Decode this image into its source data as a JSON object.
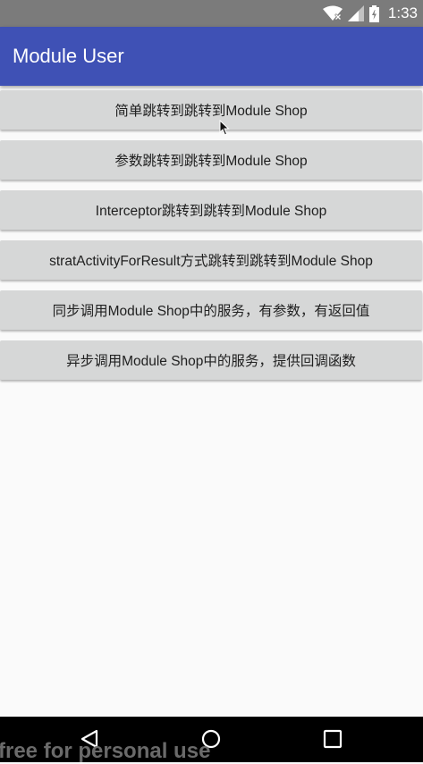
{
  "status_bar": {
    "time": "1:33",
    "icons": [
      "wifi-icon",
      "signal-icon",
      "battery-icon"
    ]
  },
  "toolbar": {
    "title": "Module User",
    "color": "#3f51b5"
  },
  "buttons": [
    {
      "label": "简单跳转到跳转到Module Shop"
    },
    {
      "label": "参数跳转到跳转到Module Shop"
    },
    {
      "label": "Interceptor跳转到跳转到Module Shop"
    },
    {
      "label": "stratActivityForResult方式跳转到跳转到Module Shop"
    },
    {
      "label": "同步调用Module Shop中的服务，有参数，有返回值"
    },
    {
      "label": "异步调用Module Shop中的服务，提供回调函数"
    }
  ],
  "nav_bar": {
    "icons": [
      "back-icon",
      "home-icon",
      "recents-icon"
    ]
  },
  "watermark": "free for personal use"
}
